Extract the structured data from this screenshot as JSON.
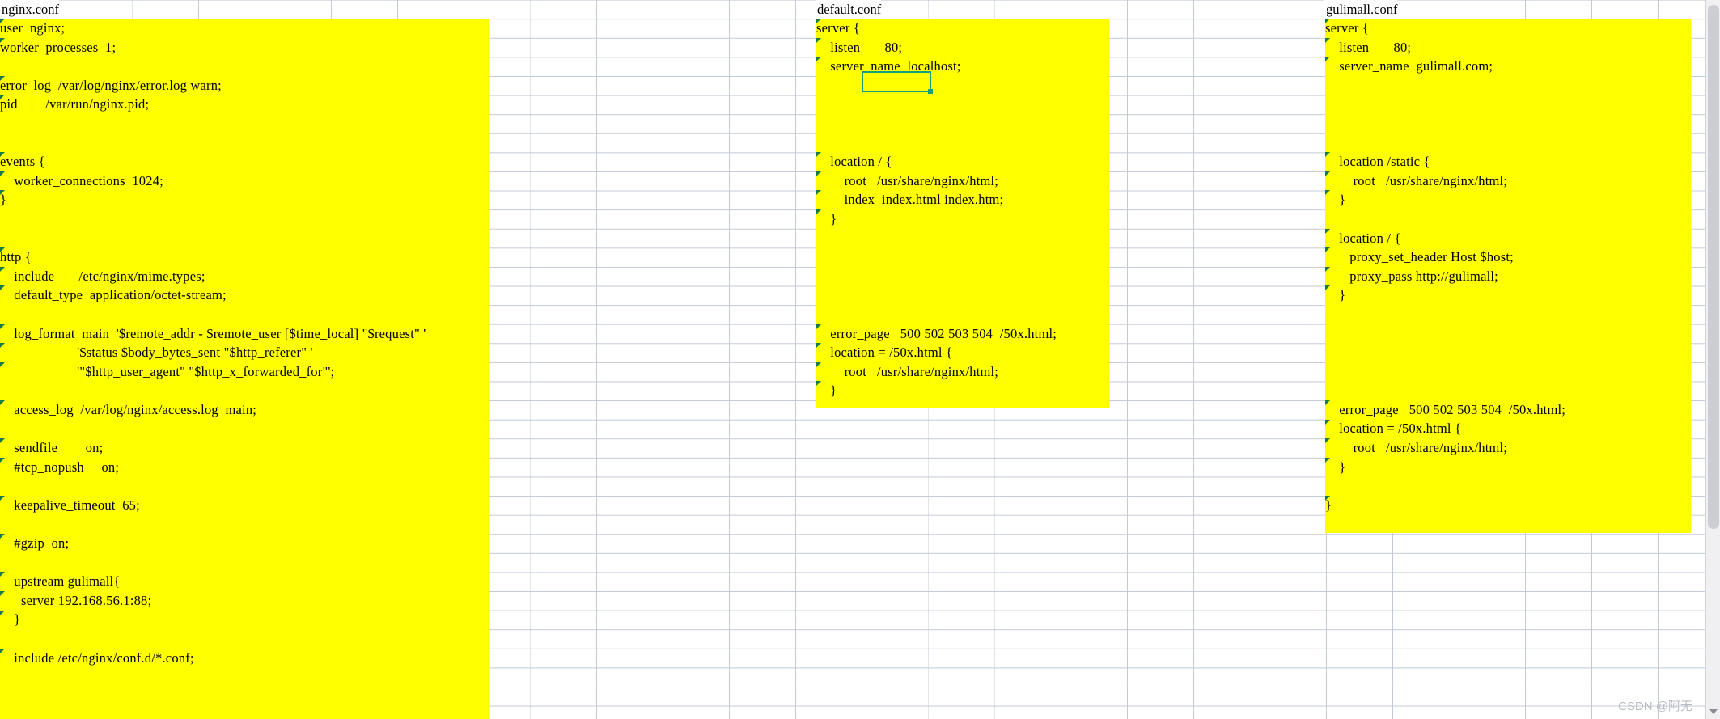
{
  "app": {
    "type": "spreadsheet",
    "accent_selection_color": "#13a07a",
    "highlight_color": "#ffff00",
    "grid_line_color": "#c3cad6",
    "error_indicator_color": "#1a7a43"
  },
  "watermark": {
    "text": "CSDN @阿无"
  },
  "scrollbar": {
    "name": "vertical-scrollbar"
  },
  "selection": {
    "name": "cell-selection-box",
    "value": ""
  },
  "columns": [
    {
      "id": "nginx",
      "header": "nginx.conf",
      "lines": [
        "user  nginx;",
        "worker_processes  1;",
        "",
        "error_log  /var/log/nginx/error.log warn;",
        "pid        /var/run/nginx.pid;",
        "",
        "",
        "events {",
        "    worker_connections  1024;",
        "}",
        "",
        "",
        "http {",
        "    include       /etc/nginx/mime.types;",
        "    default_type  application/octet-stream;",
        "",
        "    log_format  main  '$remote_addr - $remote_user [$time_local] \"$request\" '",
        "                      '$status $body_bytes_sent \"$http_referer\" '",
        "                      '\"$http_user_agent\" \"$http_x_forwarded_for\"';",
        "",
        "    access_log  /var/log/nginx/access.log  main;",
        "",
        "    sendfile        on;",
        "    #tcp_nopush     on;",
        "",
        "    keepalive_timeout  65;",
        "",
        "    #gzip  on;",
        "",
        "    upstream gulimall{",
        "      server 192.168.56.1:88;",
        "    }",
        "",
        "    include /etc/nginx/conf.d/*.conf;"
      ]
    },
    {
      "id": "default",
      "header": "default.conf",
      "lines": [
        "server {",
        "    listen       80;",
        "    server_name  localhost;",
        "",
        "",
        "",
        "",
        "    location / {",
        "        root   /usr/share/nginx/html;",
        "        index  index.html index.htm;",
        "    }",
        "",
        "",
        "",
        "",
        "",
        "    error_page   500 502 503 504  /50x.html;",
        "    location = /50x.html {",
        "        root   /usr/share/nginx/html;",
        "    }"
      ]
    },
    {
      "id": "gulimall",
      "header": "gulimall.conf",
      "lines": [
        "server {",
        "    listen       80;",
        "    server_name  gulimall.com;",
        "",
        "",
        "",
        "",
        "    location /static {",
        "        root   /usr/share/nginx/html;",
        "    }",
        "",
        "    location / {",
        "       proxy_set_header Host $host;",
        "       proxy_pass http://gulimall;",
        "    }",
        "",
        "",
        "",
        "",
        "",
        "    error_page   500 502 503 504  /50x.html;",
        "    location = /50x.html {",
        "        root   /usr/share/nginx/html;",
        "    }",
        "",
        "}"
      ]
    }
  ]
}
